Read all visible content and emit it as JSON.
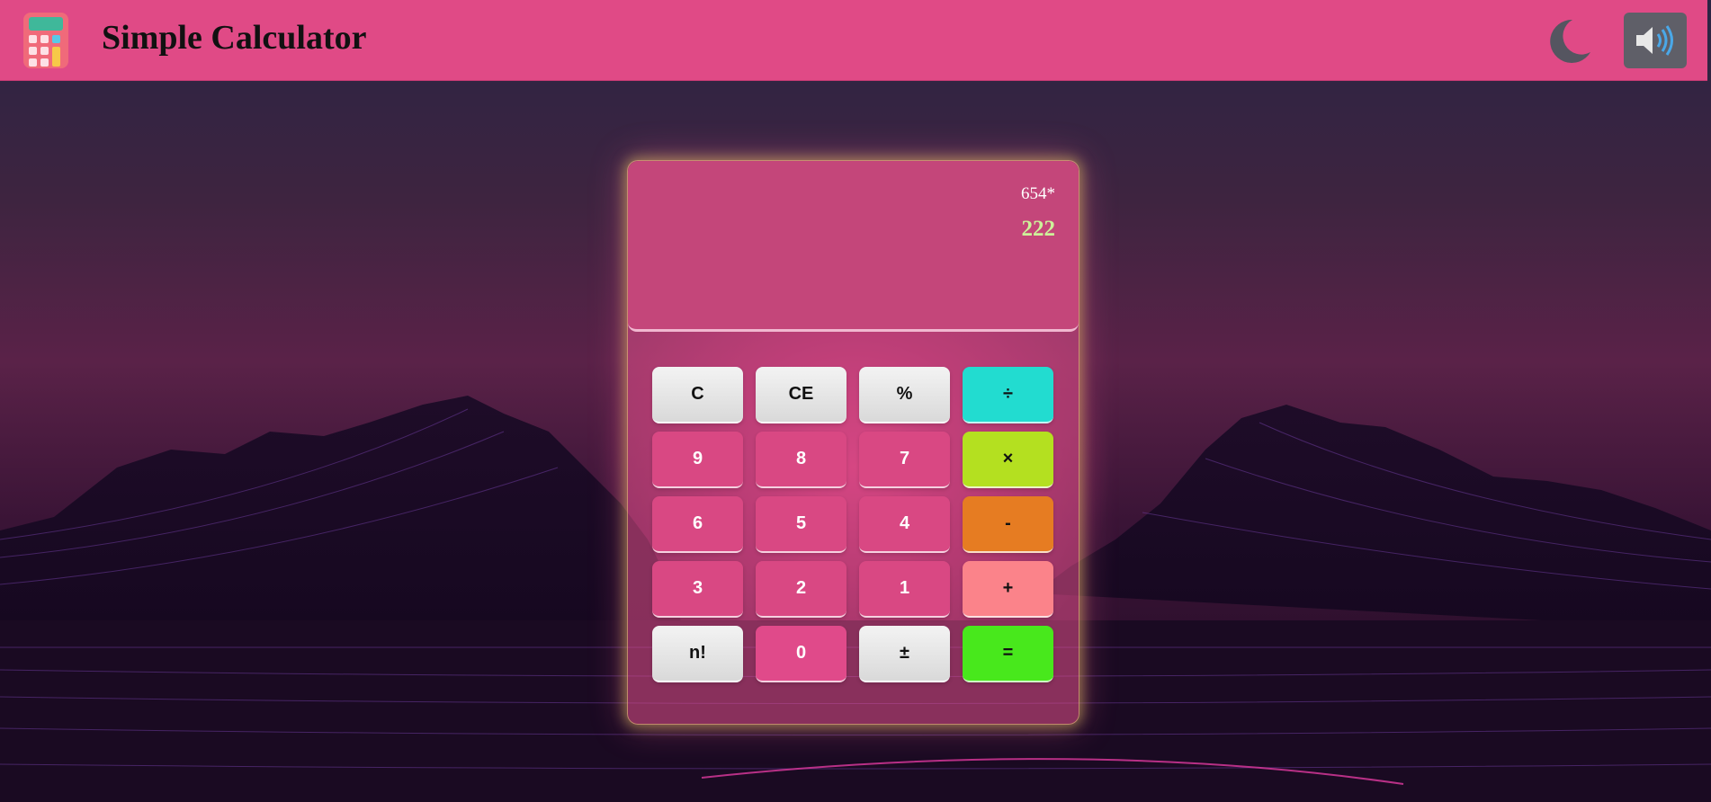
{
  "header": {
    "title": "Simple Calculator",
    "logo_icon": "calculator-icon",
    "theme_toggle_icon": "moon-icon",
    "sound_toggle_icon": "speaker-icon"
  },
  "display": {
    "expression": "654*",
    "result": "222"
  },
  "keypad": {
    "rows": [
      [
        "C",
        "CE",
        "%",
        "÷"
      ],
      [
        "9",
        "8",
        "7",
        "×"
      ],
      [
        "6",
        "5",
        "4",
        "-"
      ],
      [
        "3",
        "2",
        "1",
        "+"
      ],
      [
        "n!",
        "0",
        "±",
        "="
      ]
    ]
  },
  "colors": {
    "header_bg": "#e04a86",
    "display_bg": "#c4467a",
    "result_text": "#cdf29a",
    "digit_key": "#d94883",
    "divide_key": "#22dcd0",
    "multiply_key": "#b4e020",
    "subtract_key": "#e67c22",
    "add_key": "#fb838a",
    "equals_key": "#48e81c",
    "light_key": "#e8e8e8"
  }
}
